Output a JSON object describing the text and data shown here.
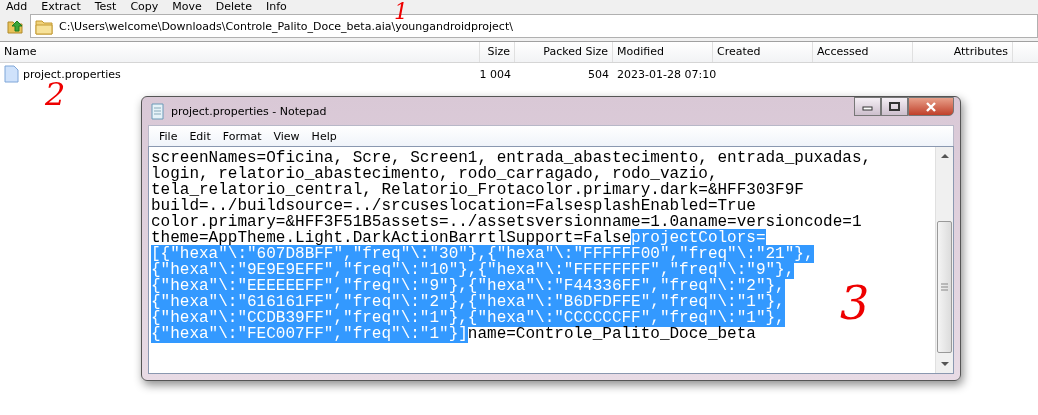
{
  "toolbar": {
    "buttons": [
      "Add",
      "Extract",
      "Test",
      "Copy",
      "Move",
      "Delete",
      "Info"
    ]
  },
  "address_bar": {
    "path": "C:\\Users\\welcome\\Downloads\\Controle_Palito_Doce_beta.aia\\youngandroidproject\\"
  },
  "file_list": {
    "columns": [
      {
        "label": "Name"
      },
      {
        "label": "Size"
      },
      {
        "label": "Packed Size"
      },
      {
        "label": "Modified"
      },
      {
        "label": "Created"
      },
      {
        "label": "Accessed"
      },
      {
        "label": "Attributes"
      }
    ],
    "rows": [
      {
        "cells": [
          "project.properties",
          "1 004",
          "504",
          "2023-01-28 07:10",
          "",
          "",
          ""
        ]
      }
    ]
  },
  "notepad": {
    "title": "project.properties - Notepad",
    "menu": [
      "File",
      "Edit",
      "Format",
      "View",
      "Help"
    ],
    "lines": [
      [
        {
          "text": "screenNames=Oficina, Scre, Screen1, entrada_abastecimento, entrada_puxadas,",
          "selected": false
        }
      ],
      [
        {
          "text": "login, relatorio_abastecimento, rodo_carragado, rodo_vazio,",
          "selected": false
        }
      ],
      [
        {
          "text": "tela_relatorio_central, Relatorio_Frotacolor.primary.dark=&HFF303F9F",
          "selected": false
        }
      ],
      [
        {
          "text": "build=../buildsource=../srcuseslocation=FalsesplashEnabled=True",
          "selected": false
        }
      ],
      [
        {
          "text": "color.primary=&HFF3F51B5assets=../assetsversionname=1.0aname=versioncode=1",
          "selected": false
        }
      ],
      [
        {
          "text": "theme=AppTheme.Light.DarkActionBarrtlSupport=False",
          "selected": false
        },
        {
          "text": "projectColors=",
          "selected": true
        }
      ],
      [
        {
          "text": "[{\"hexa\"\\:\"607D8BFF\",\"freq\"\\:\"30\"},{\"hexa\"\\:\"FFFFFF00\",\"freq\"\\:\"21\"},",
          "selected": true
        }
      ],
      [
        {
          "text": "{\"hexa\"\\:\"9E9E9EFF\",\"freq\"\\:\"10\"},{\"hexa\"\\:\"FFFFFFFF\",\"freq\"\\:\"9\"},",
          "selected": true
        }
      ],
      [
        {
          "text": "{\"hexa\"\\:\"EEEEEEFF\",\"freq\"\\:\"9\"},{\"hexa\"\\:\"F44336FF\",\"freq\"\\:\"2\"},",
          "selected": true
        }
      ],
      [
        {
          "text": "{\"hexa\"\\:\"616161FF\",\"freq\"\\:\"2\"},{\"hexa\"\\:\"B6DFDFFE\",\"freq\"\\:\"1\"},",
          "selected": true
        }
      ],
      [
        {
          "text": "{\"hexa\"\\:\"CCDB39FF\",\"freq\"\\:\"1\"},{\"hexa\"\\:\"CCCCCCFF\",\"freq\"\\:\"1\"},",
          "selected": true
        }
      ],
      [
        {
          "text": "{\"hexa\"\\:\"FEC007FF\",\"freq\"\\:\"1\"}]",
          "selected": true
        },
        {
          "text": "name=Controle_Palito_Doce_beta",
          "selected": false
        }
      ]
    ]
  },
  "annotations": [
    {
      "text": "1"
    },
    {
      "text": "2"
    },
    {
      "text": "3"
    }
  ]
}
